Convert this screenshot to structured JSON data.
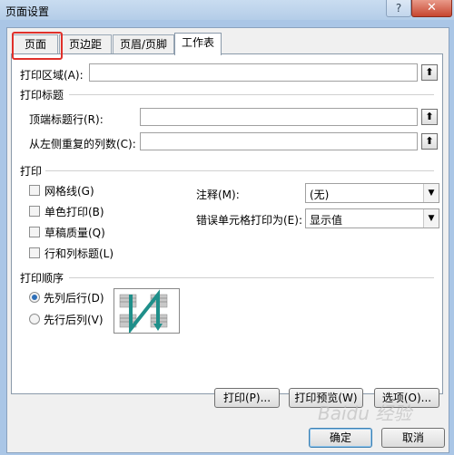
{
  "window": {
    "title": "页面设置",
    "help": "?",
    "close": "✕"
  },
  "tabs": [
    {
      "label": "页面"
    },
    {
      "label": "页边距"
    },
    {
      "label": "页眉/页脚"
    },
    {
      "label": "工作表"
    }
  ],
  "print_area": {
    "label": "打印区域(A):",
    "value": "",
    "button": "⬆"
  },
  "print_titles": {
    "group": "打印标题",
    "rows_label": "顶端标题行(R):",
    "rows_value": "",
    "cols_label": "从左侧重复的列数(C):",
    "cols_value": "",
    "button": "⬆"
  },
  "print": {
    "group": "打印",
    "checkboxes": [
      {
        "label": "网格线(G)",
        "checked": false
      },
      {
        "label": "单色打印(B)",
        "checked": false
      },
      {
        "label": "草稿质量(Q)",
        "checked": false
      },
      {
        "label": "行和列标题(L)",
        "checked": false
      }
    ],
    "comments_label": "注释(M):",
    "comments_value": "(无)",
    "errors_label": "错误单元格打印为(E):",
    "errors_value": "显示值",
    "dropdown_icon": "▼"
  },
  "page_order": {
    "group": "打印顺序",
    "options": [
      {
        "label": "先列后行(D)",
        "selected": true
      },
      {
        "label": "先行后列(V)",
        "selected": false
      }
    ]
  },
  "footer_buttons": {
    "print": "打印(P)...",
    "preview": "打印预览(W)",
    "options": "选项(O)..."
  },
  "dialog_buttons": {
    "ok": "确定",
    "cancel": "取消"
  },
  "watermark": "Baidu 经验",
  "colors": {
    "accent": "#2e6fb8",
    "highlight": "#e0302a",
    "diagram": "#1f8f8a"
  }
}
